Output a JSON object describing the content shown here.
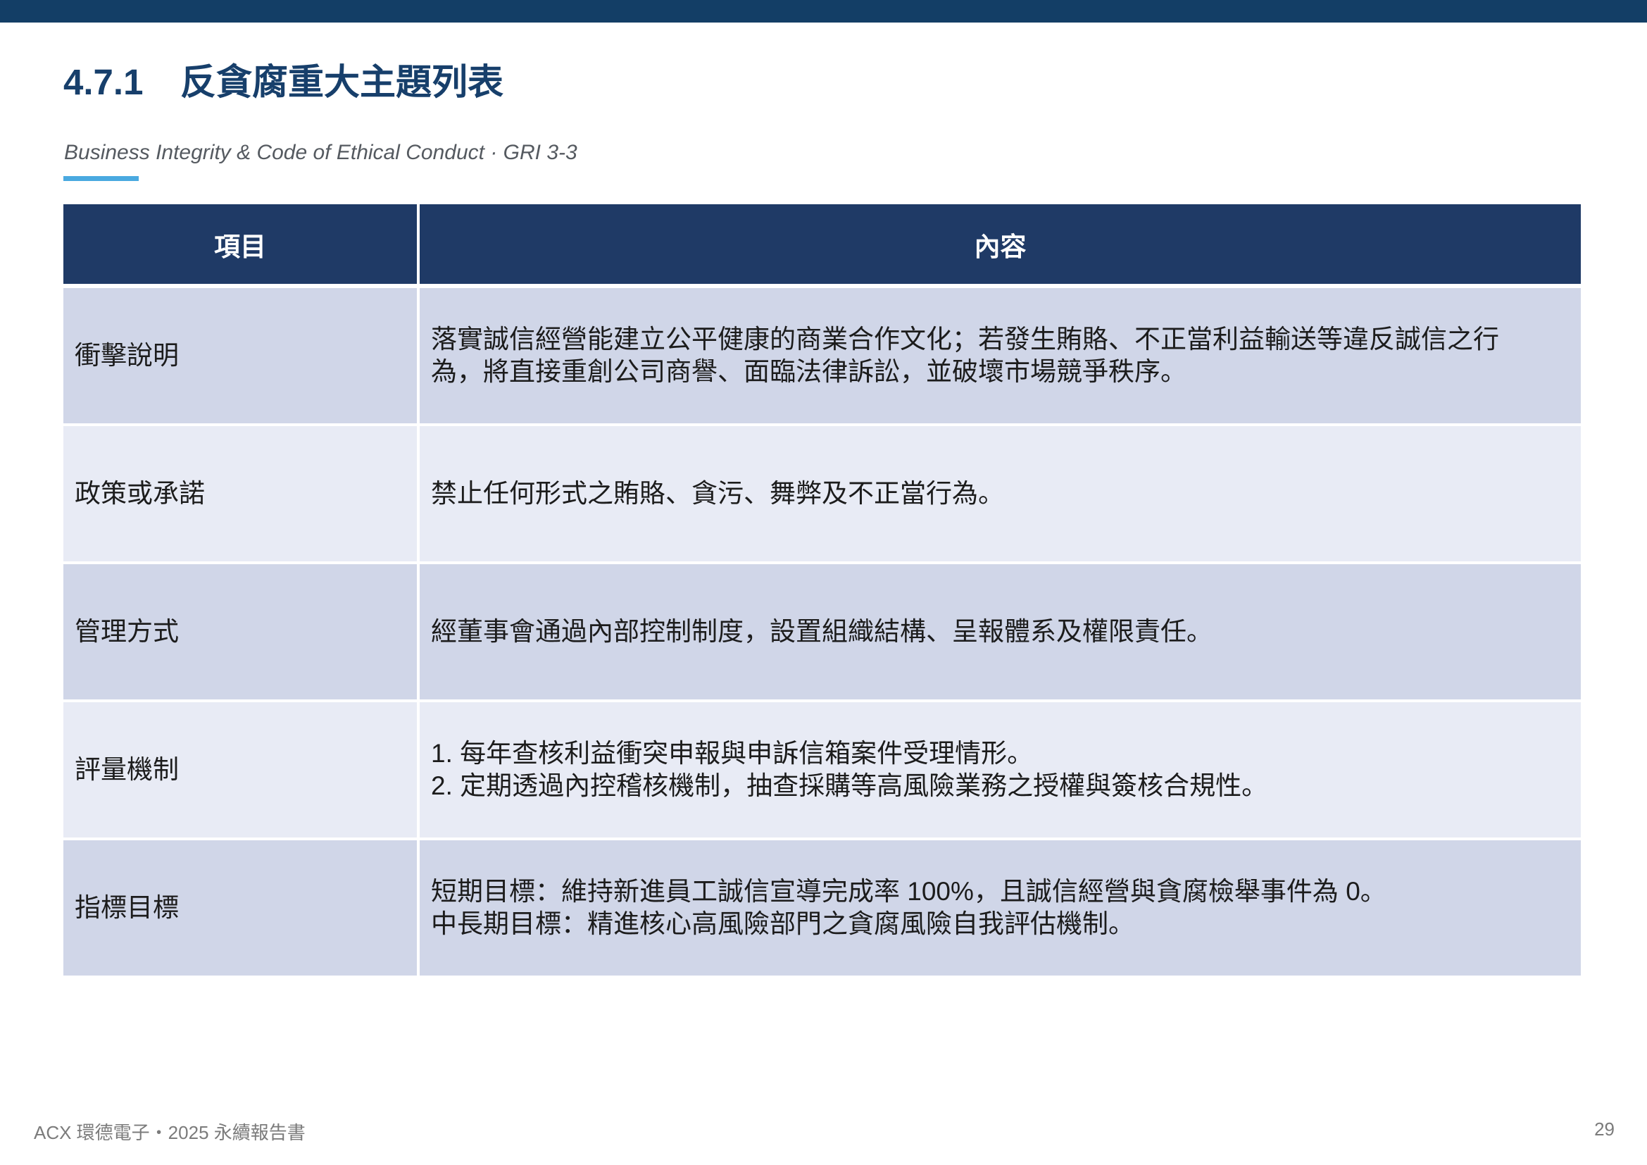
{
  "header": {
    "section_number": "4.7.1",
    "section_title": "反貪腐重大主題列表",
    "subtitle": "Business Integrity & Code of Ethical Conduct · GRI 3-3"
  },
  "table": {
    "columns": [
      "項目",
      "內容"
    ],
    "rows": [
      {
        "label": "衝擊說明",
        "lines": [
          "落實誠信經營能建立公平健康的商業合作文化；若發生賄賂、不正當利益輸送等違反誠信之行",
          "為，將直接重創公司商譽、面臨法律訴訟，並破壞市場競爭秩序。"
        ]
      },
      {
        "label": "政策或承諾",
        "lines": [
          "禁止任何形式之賄賂、貪污、舞弊及不正當行為。"
        ]
      },
      {
        "label": "管理方式",
        "lines": [
          "經董事會通過內部控制制度，設置組織結構、呈報體系及權限責任。"
        ]
      },
      {
        "label": "評量機制",
        "lines": [
          "1. 每年查核利益衝突申報與申訴信箱案件受理情形。",
          "2. 定期透過內控稽核機制，抽查採購等高風險業務之授權與簽核合規性。"
        ]
      },
      {
        "label": "指標目標",
        "lines": [
          "短期目標：維持新進員工誠信宣導完成率 100%，且誠信經營與貪腐檢舉事件為 0。",
          "中長期目標：精進核心高風險部門之貪腐風險自我評估機制。"
        ]
      }
    ]
  },
  "footer": {
    "left": "ACX 環德電子・2025 永續報告書",
    "page_number": "29"
  }
}
